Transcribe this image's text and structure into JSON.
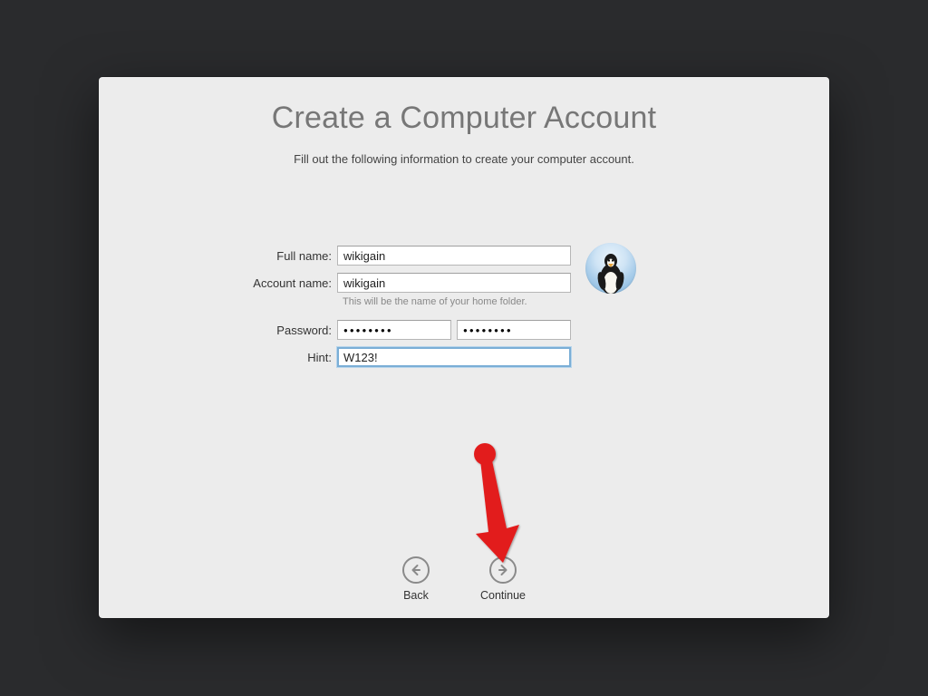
{
  "header": {
    "title": "Create a Computer Account",
    "subtitle": "Fill out the following information to create your computer account."
  },
  "form": {
    "full_name_label": "Full name:",
    "full_name_value": "wikigain",
    "account_name_label": "Account name:",
    "account_name_value": "wikigain",
    "account_name_helper": "This will be the name of your home folder.",
    "password_label": "Password:",
    "password_value": "●●●●●●●●",
    "password_confirm_value": "●●●●●●●●",
    "hint_label": "Hint:",
    "hint_value": "W123!"
  },
  "nav": {
    "back_label": "Back",
    "continue_label": "Continue"
  },
  "avatar": {
    "name": "penguin-avatar"
  },
  "annotation": {
    "type": "red-arrow",
    "points_to": "continue-button"
  }
}
